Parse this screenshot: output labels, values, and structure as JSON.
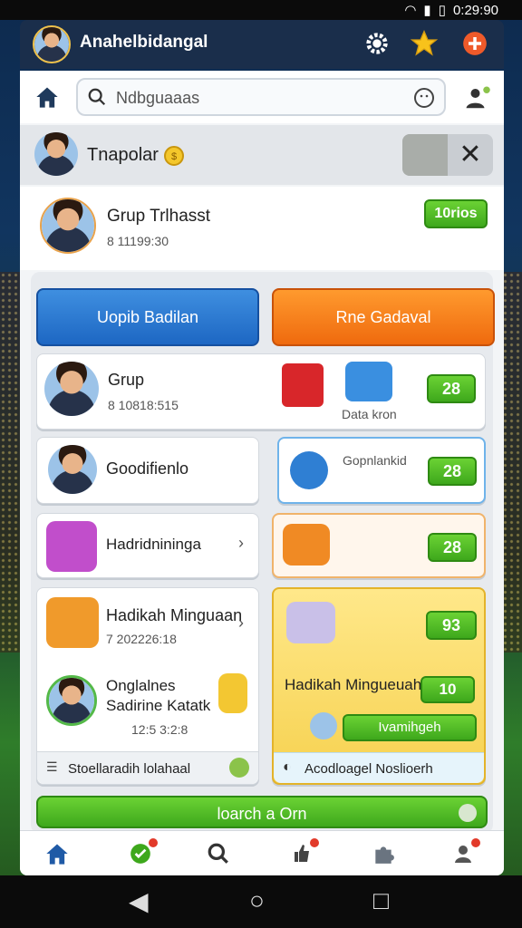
{
  "status": {
    "time": "0:29:90"
  },
  "topbar": {
    "username": "Anahelbidangal"
  },
  "search": {
    "placeholder": "Ndbguaaas"
  },
  "header": {
    "title": "Tnapolar"
  },
  "group_top": {
    "title": "Grup Trlhasst",
    "subtitle": "8 11199:30",
    "badge": "10rios"
  },
  "buttons": {
    "blue": "Uopib Badilan",
    "orange": "Rne Gadaval"
  },
  "cards": {
    "grup": {
      "title": "Grup",
      "subtitle": "8 10818:515"
    },
    "gift_label": "Data kron",
    "gift_badge": "28",
    "goodi": {
      "title": "Goodifienlo"
    },
    "gopn": {
      "title": "Gopnlankid",
      "badge": "28"
    },
    "hadui": {
      "title": "Hadridnininga"
    },
    "orange_badge": "28",
    "hadiah": {
      "title": "Hadikah Minguaan",
      "subtitle": "7 202226:18"
    },
    "yellow": {
      "badge": "93",
      "title": "Hadikah Mingueuah",
      "coin": "10"
    },
    "ongral": {
      "line1": "Onglalnes",
      "line2": "Sadirine Katatk",
      "subtitle": "12:5 3:2:8"
    },
    "bottom_left": "Stoellaradih lolahaal",
    "green_pill": "Ivamihgeh",
    "bottom_right": "Acodloagel Noslioerh"
  },
  "cta": "loarch a Orn",
  "colors": {
    "accent_green": "#3ea81c",
    "accent_blue": "#1d67c3",
    "accent_orange": "#ef6a0e",
    "topbar": "#1a2e4b"
  }
}
